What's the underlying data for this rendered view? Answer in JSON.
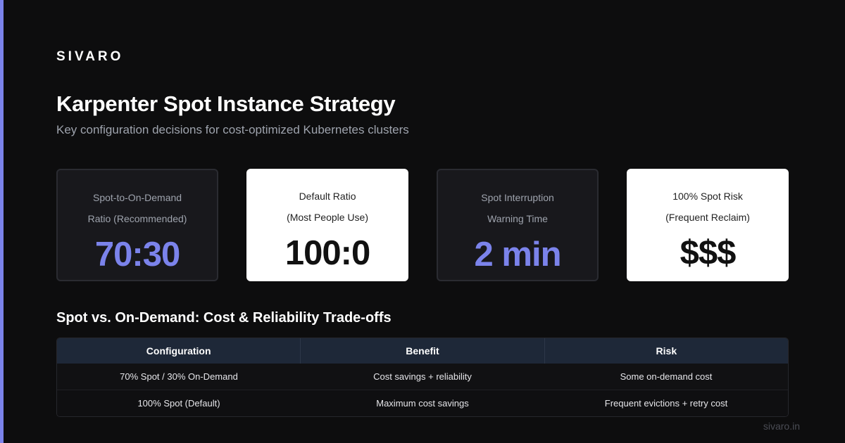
{
  "brand": "SIVARO",
  "title": "Karpenter Spot Instance Strategy",
  "subtitle": "Key configuration decisions for cost-optimized Kubernetes clusters",
  "colors": {
    "accent": "#7b83eb",
    "background": "#0d0d0e",
    "card_dark": "#18181c",
    "card_light": "#ffffff",
    "table_header": "#1e2838"
  },
  "cards": [
    {
      "label_line1": "Spot-to-On-Demand",
      "label_line2": "Ratio (Recommended)",
      "value": "70:30",
      "style": "dark"
    },
    {
      "label_line1": "Default Ratio",
      "label_line2": "(Most People Use)",
      "value": "100:0",
      "style": "light"
    },
    {
      "label_line1": "Spot Interruption",
      "label_line2": "Warning Time",
      "value": "2 min",
      "style": "dark"
    },
    {
      "label_line1": "100% Spot Risk",
      "label_line2": "(Frequent Reclaim)",
      "value": "$$$",
      "style": "light"
    }
  ],
  "section_title": "Spot vs. On-Demand: Cost & Reliability Trade-offs",
  "table": {
    "headers": [
      "Configuration",
      "Benefit",
      "Risk"
    ],
    "rows": [
      [
        "70% Spot / 30% On-Demand",
        "Cost savings + reliability",
        "Some on-demand cost"
      ],
      [
        "100% Spot (Default)",
        "Maximum cost savings",
        "Frequent evictions + retry cost"
      ]
    ]
  },
  "footer": "sivaro.in"
}
